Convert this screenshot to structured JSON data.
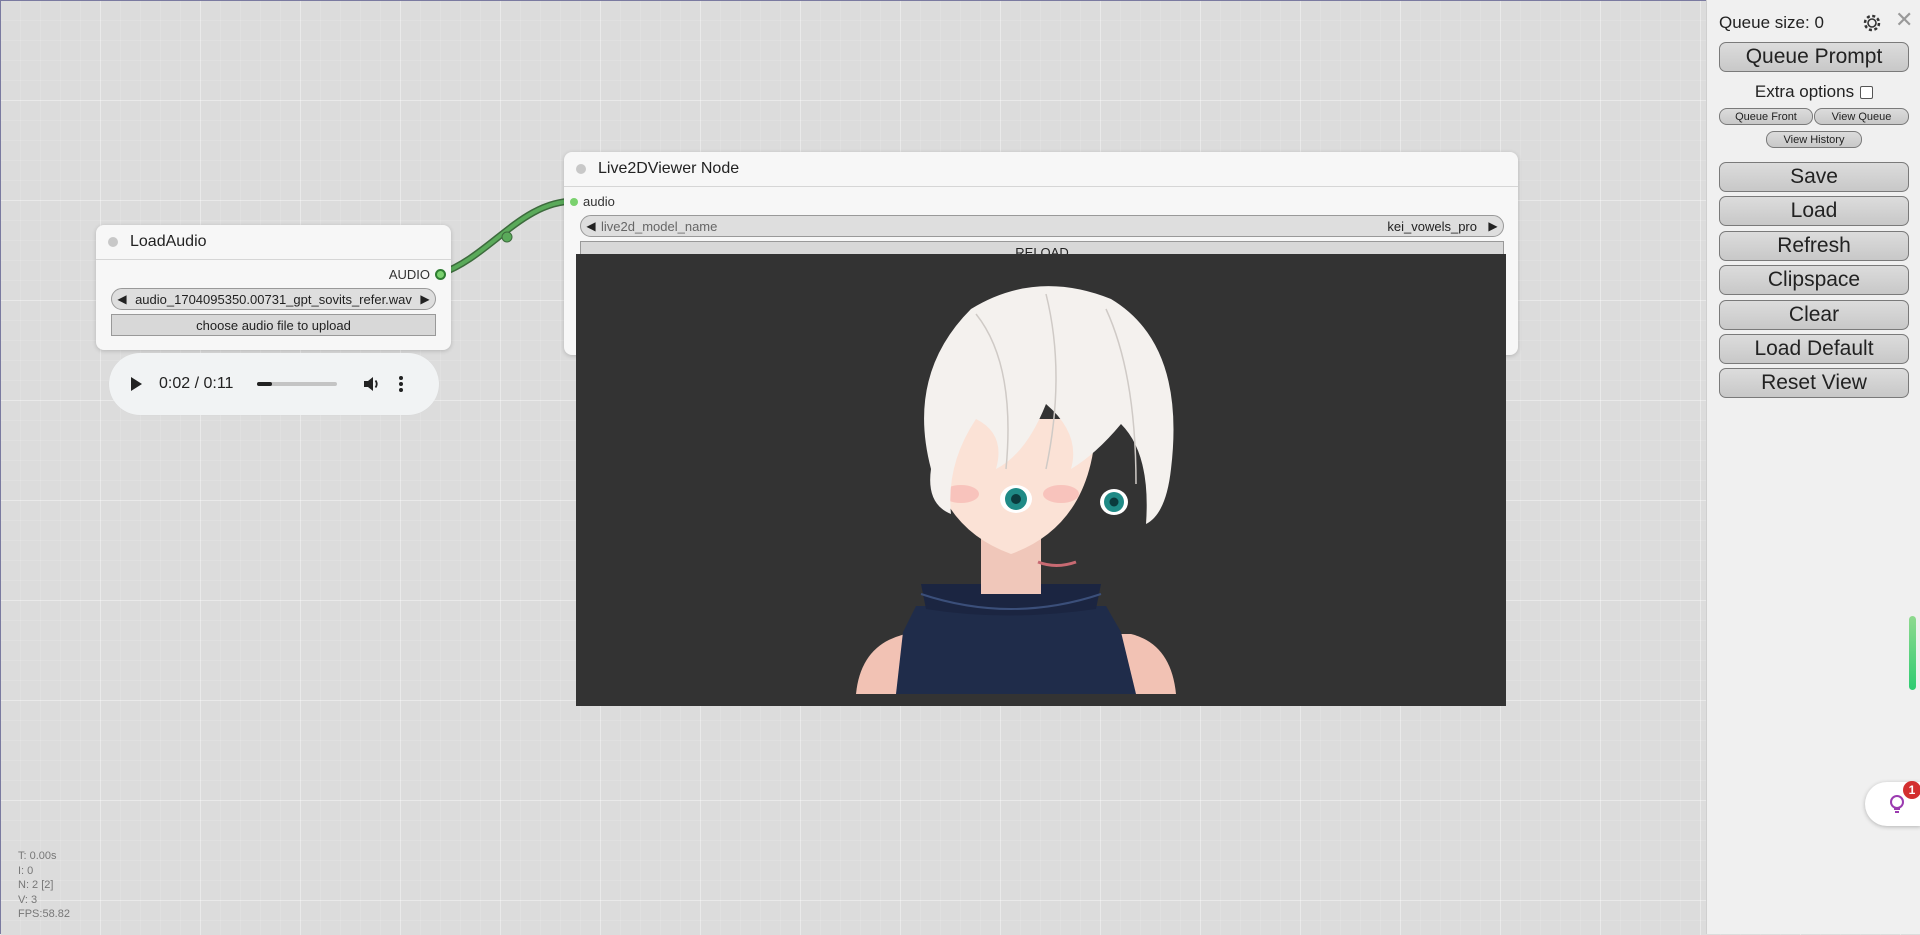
{
  "nodes": {
    "load_audio": {
      "title": "LoadAudio",
      "output_label": "AUDIO",
      "file_value": "audio_1704095350.00731_gpt_sovits_refer.wav",
      "upload_label": "choose audio file to upload"
    },
    "live2d_viewer": {
      "title": "Live2DViewer Node",
      "input_label": "audio",
      "model_widget_label": "live2d_model_name",
      "model_widget_value": "kei_vowels_pro",
      "reload_label": "RELOAD"
    }
  },
  "audio_player": {
    "time": "0:02 / 0:11",
    "progress": 0.18
  },
  "sidebar": {
    "queue_size": "Queue size: 0",
    "queue_prompt": "Queue Prompt",
    "extra_options": "Extra options",
    "queue_front": "Queue Front",
    "view_queue": "View Queue",
    "view_history": "View History",
    "buttons": [
      "Save",
      "Load",
      "Refresh",
      "Clipspace",
      "Clear",
      "Load Default",
      "Reset View"
    ]
  },
  "notification_badge": "1",
  "stats": {
    "t": "T: 0.00s",
    "i": "I: 0",
    "n": "N: 2 [2]",
    "v": "V: 3",
    "fps": "FPS:58.82"
  },
  "colors": {
    "canvas_bg": "#dcdcdc",
    "link": "#4a9a4a",
    "slot_on": "#7ad16e",
    "preview_bg": "#333333",
    "badge": "#d32f2f"
  }
}
